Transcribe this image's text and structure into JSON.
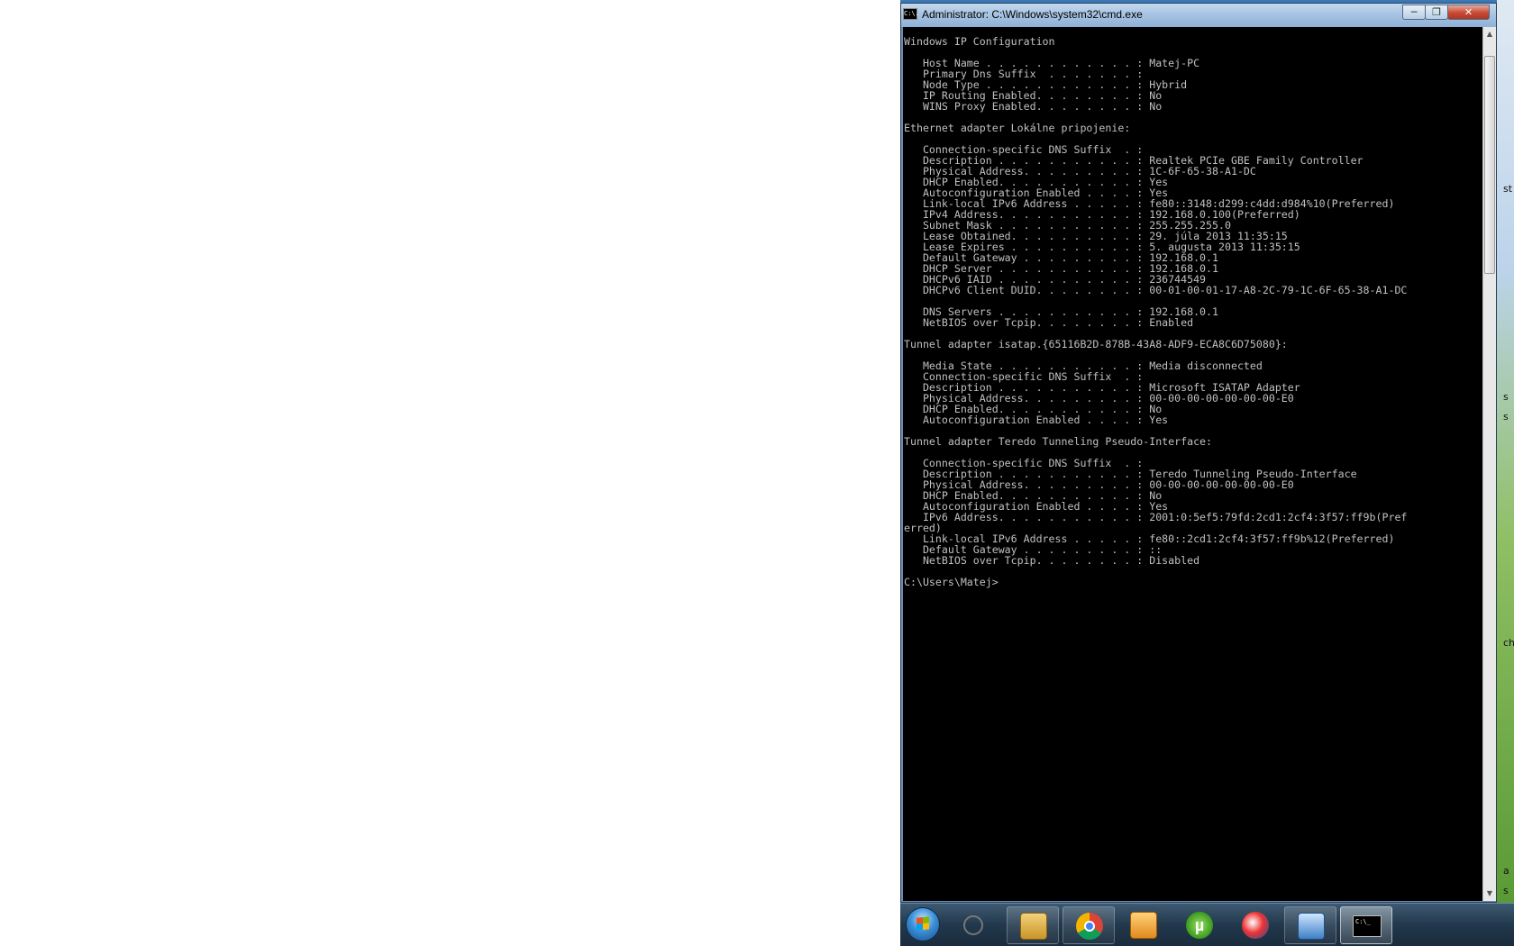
{
  "window": {
    "title": "Administrator: C:\\Windows\\system32\\cmd.exe",
    "icon_label": "C:\\.",
    "min_symbol": "─",
    "max_symbol": "❐",
    "close_symbol": "✕"
  },
  "console": {
    "lines": [
      "Windows IP Configuration",
      "",
      "   Host Name . . . . . . . . . . . . : Matej-PC",
      "   Primary Dns Suffix  . . . . . . . :",
      "   Node Type . . . . . . . . . . . . : Hybrid",
      "   IP Routing Enabled. . . . . . . . : No",
      "   WINS Proxy Enabled. . . . . . . . : No",
      "",
      "Ethernet adapter Lokálne pripojenie:",
      "",
      "   Connection-specific DNS Suffix  . :",
      "   Description . . . . . . . . . . . : Realtek PCIe GBE Family Controller",
      "   Physical Address. . . . . . . . . : 1C-6F-65-38-A1-DC",
      "   DHCP Enabled. . . . . . . . . . . : Yes",
      "   Autoconfiguration Enabled . . . . : Yes",
      "   Link-local IPv6 Address . . . . . : fe80::3148:d299:c4dd:d984%10(Preferred)",
      "   IPv4 Address. . . . . . . . . . . : 192.168.0.100(Preferred)",
      "   Subnet Mask . . . . . . . . . . . : 255.255.255.0",
      "   Lease Obtained. . . . . . . . . . : 29. júla 2013 11:35:15",
      "   Lease Expires . . . . . . . . . . : 5. augusta 2013 11:35:15",
      "   Default Gateway . . . . . . . . . : 192.168.0.1",
      "   DHCP Server . . . . . . . . . . . : 192.168.0.1",
      "   DHCPv6 IAID . . . . . . . . . . . : 236744549",
      "   DHCPv6 Client DUID. . . . . . . . : 00-01-00-01-17-A8-2C-79-1C-6F-65-38-A1-DC",
      "",
      "   DNS Servers . . . . . . . . . . . : 192.168.0.1",
      "   NetBIOS over Tcpip. . . . . . . . : Enabled",
      "",
      "Tunnel adapter isatap.{65116B2D-878B-43A8-ADF9-ECA8C6D75080}:",
      "",
      "   Media State . . . . . . . . . . . : Media disconnected",
      "   Connection-specific DNS Suffix  . :",
      "   Description . . . . . . . . . . . : Microsoft ISATAP Adapter",
      "   Physical Address. . . . . . . . . : 00-00-00-00-00-00-00-E0",
      "   DHCP Enabled. . . . . . . . . . . : No",
      "   Autoconfiguration Enabled . . . . : Yes",
      "",
      "Tunnel adapter Teredo Tunneling Pseudo-Interface:",
      "",
      "   Connection-specific DNS Suffix  . :",
      "   Description . . . . . . . . . . . : Teredo Tunneling Pseudo-Interface",
      "   Physical Address. . . . . . . . . : 00-00-00-00-00-00-00-E0",
      "   DHCP Enabled. . . . . . . . . . . : No",
      "   Autoconfiguration Enabled . . . . : Yes",
      "   IPv6 Address. . . . . . . . . . . : 2001:0:5ef5:79fd:2cd1:2cf4:3f57:ff9b(Pref",
      "erred)",
      "   Link-local IPv6 Address . . . . . : fe80::2cd1:2cf4:3f57:ff9b%12(Preferred)",
      "   Default Gateway . . . . . . . . . : ::",
      "   NetBIOS over Tcpip. . . . . . . . : Disabled",
      "",
      "C:\\Users\\Matej>"
    ]
  },
  "scrollbar": {
    "up_symbol": "▲",
    "down_symbol": "▼"
  },
  "desktop_peek": {
    "fragments": [
      "st",
      "s",
      "s",
      "ch",
      "a",
      "s"
    ]
  },
  "taskbar": {
    "items": [
      {
        "name": "disabled-icon"
      },
      {
        "name": "explorer-icon"
      },
      {
        "name": "chrome-icon"
      },
      {
        "name": "media-player-icon"
      },
      {
        "name": "utorrent-icon",
        "glyph": "µ"
      },
      {
        "name": "app-icon"
      },
      {
        "name": "network-icon"
      },
      {
        "name": "cmd-icon",
        "glyph": "C:\\_"
      }
    ]
  },
  "colors": {
    "console_bg": "#000000",
    "console_fg": "#c0c0c0",
    "close_button": "#c74a36"
  }
}
